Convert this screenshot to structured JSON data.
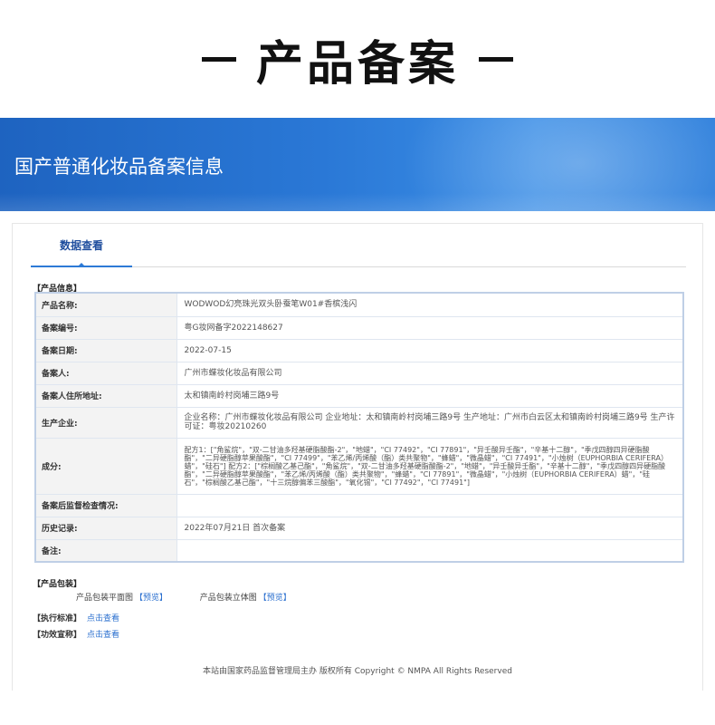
{
  "header": {
    "title": "产品备案"
  },
  "banner": {
    "title": "国产普通化妆品备案信息"
  },
  "tabs": [
    {
      "label": "数据查看"
    }
  ],
  "product_info": {
    "section_label": "【产品信息】",
    "rows": [
      {
        "label": "产品名称:",
        "value": "WODWOD幻亮珠光双头卧蚕笔W01#香槟浅闪"
      },
      {
        "label": "备案编号:",
        "value": "粤G妆网备字2022148627"
      },
      {
        "label": "备案日期:",
        "value": "2022-07-15"
      },
      {
        "label": "备案人:",
        "value": "广州市蝶妆化妆品有限公司"
      },
      {
        "label": "备案人住所地址:",
        "value": "太和镇南岭村岗埔三路9号"
      },
      {
        "label": "生产企业:",
        "value": "企业名称：广州市蝶妆化妆品有限公司 企业地址：太和镇南岭村岗埔三路9号 生产地址：广州市白云区太和镇南岭村岗埔三路9号 生产许可证：粤妆20210260"
      },
      {
        "label": "成分:",
        "value": "配方1：[\"角鲨烷\"，\"双-二甘油多羟基硬脂酸酯-2\"，\"地蜡\"，\"CI 77492\"，\"CI 77891\"，\"异壬酸异壬酯\"，\"辛基十二醇\"，\"季戊四醇四异硬脂酸酯\"，\"二异硬脂醇苹果酸酯\"，\"CI 77499\"，\"苯乙烯/丙烯酸（酯）类共聚物\"，\"蜂蜡\"，\"微晶蜡\"，\"CI 77491\"，\"小烛树（EUPHORBIA CERIFERA）蜡\"，\"硅石\"] 配方2：[\"棕榈酸乙基己酯\"，\"角鲨烷\"，\"双-二甘油多羟基硬脂酸酯-2\"，\"地蜡\"，\"异壬酸异壬酯\"，\"辛基十二醇\"，\"季戊四醇四异硬脂酸酯\"，\"二异硬脂醇苹果酸酯\"，\"苯乙烯/丙烯酸（酯）类共聚物\"，\"蜂蜡\"，\"CI 77891\"，\"微晶蜡\"，\"小烛树（EUPHORBIA CERIFERA）蜡\"，\"硅石\"，\"棕榈酸乙基己酯\"，\"十三烷醇偏苯三酸酯\"，\"氧化锡\"，\"CI 77492\"，\"CI 77491\"]"
      },
      {
        "label": "备案后监督检查情况:",
        "value": ""
      },
      {
        "label": "历史记录:",
        "value": "2022年07月21日 首次备案"
      },
      {
        "label": "备注:",
        "value": ""
      }
    ]
  },
  "packaging": {
    "section_label": "【产品包装】",
    "flat_label": "产品包装平面图",
    "flat_link": "【预览】",
    "solid_label": "产品包装立体图",
    "solid_link": "【预览】"
  },
  "standard": {
    "label": "【执行标准】",
    "link": "点击查看"
  },
  "efficacy": {
    "label": "【功效宣称】",
    "link": "点击查看"
  },
  "footer": {
    "text": "本站由国家药品监督管理局主办 版权所有 Copyright © NMPA All Rights Reserved"
  },
  "colors": {
    "banner": "#2a78d6",
    "tab_accent": "#2d7ad6",
    "link": "#2a6fcf"
  }
}
